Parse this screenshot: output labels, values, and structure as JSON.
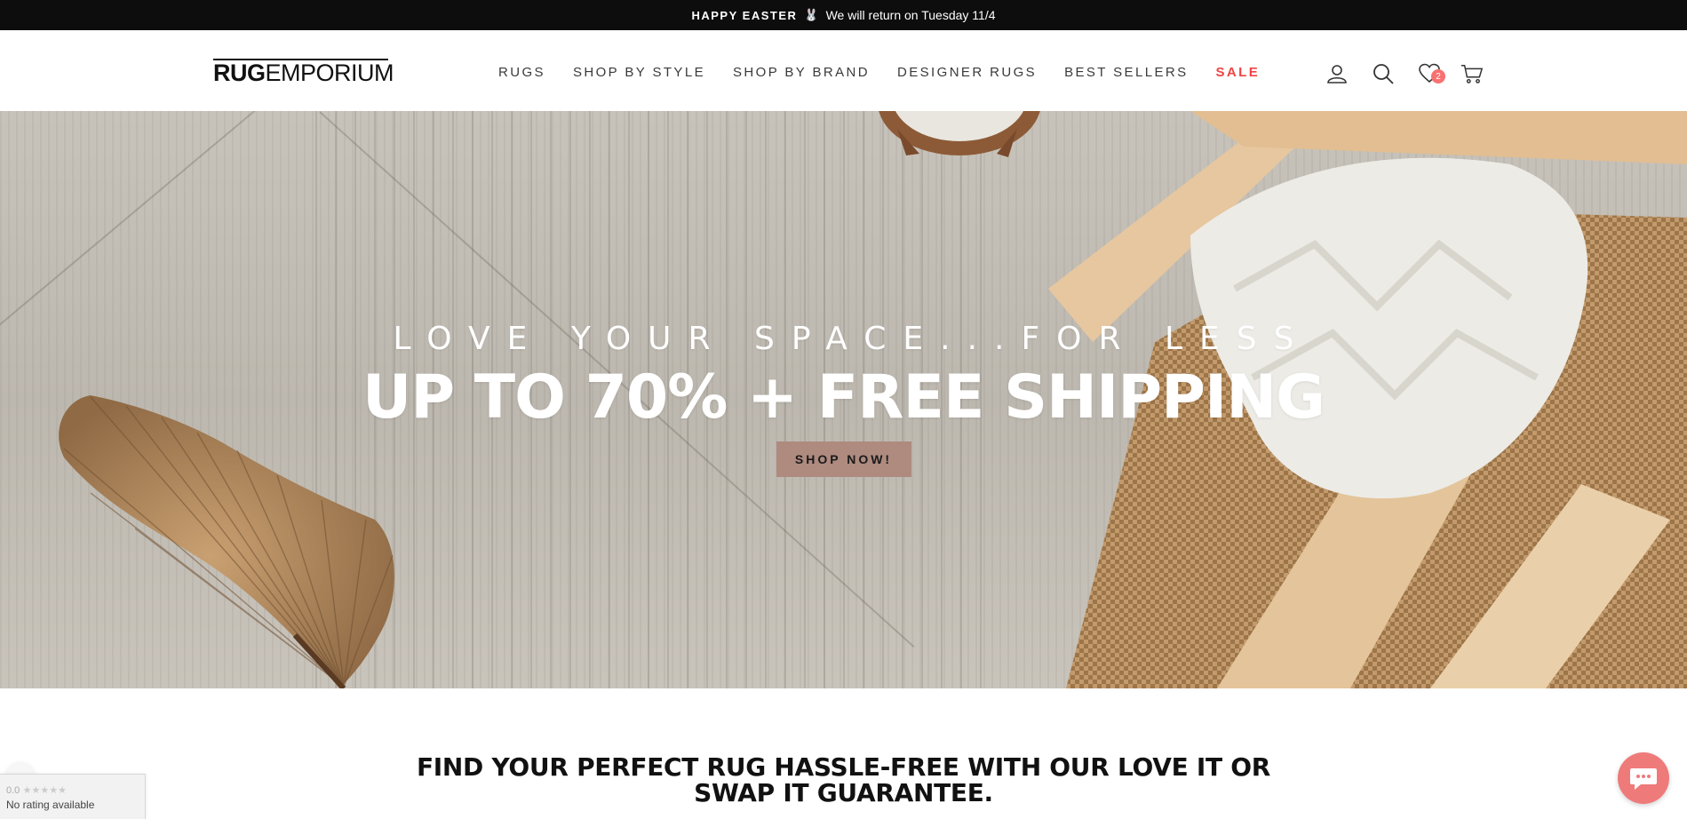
{
  "announcement": {
    "bold": "HAPPY EASTER",
    "icon": "bunny-icon",
    "message": "We will return on Tuesday 11/4"
  },
  "header": {
    "logo_bold": "RUG",
    "logo_light": "EMPORIUM",
    "nav": [
      {
        "label": "RUGS"
      },
      {
        "label": "SHOP BY STYLE"
      },
      {
        "label": "SHOP BY BRAND"
      },
      {
        "label": "DESIGNER RUGS"
      },
      {
        "label": "BEST SELLERS"
      },
      {
        "label": "SALE",
        "color": "#ef4444"
      }
    ],
    "wishlist_count": "2",
    "icons": [
      "account-icon",
      "search-icon",
      "wishlist-heart-icon",
      "cart-icon"
    ]
  },
  "hero": {
    "tagline": "LOVE YOUR SPACE...FOR LESS",
    "headline": "UP TO 70% + FREE SHIPPING",
    "cta": "SHOP NOW!",
    "cta_color": "#ae8a7f"
  },
  "guarantee": {
    "line1": "FIND YOUR PERFECT RUG HASSLE-FREE WITH OUR LOVE IT OR",
    "line2": "SWAP IT GUARANTEE."
  },
  "rating_widget": {
    "score": "0.0",
    "stars": "★★★★★",
    "label": "No rating available"
  },
  "chat": {
    "icon": "chat-bubble-icon",
    "color": "#ef7a7a"
  }
}
